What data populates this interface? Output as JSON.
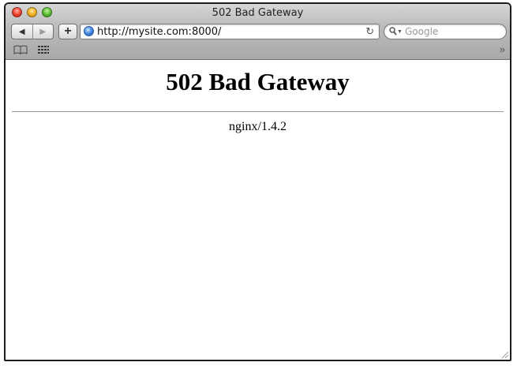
{
  "window": {
    "title": "502 Bad Gateway"
  },
  "toolbar": {
    "back_icon": "back-arrow-icon",
    "forward_icon": "forward-arrow-icon",
    "add_label": "+",
    "url": "http://mysite.com:8000/",
    "reload_icon": "reload-icon",
    "search_placeholder": "Google"
  },
  "bookmarks": {
    "more_label": "»"
  },
  "page": {
    "heading": "502 Bad Gateway",
    "server": "nginx/1.4.2"
  },
  "colors": {
    "close": "#f0442f",
    "minimize": "#f4b223",
    "maximize": "#5bc235"
  }
}
